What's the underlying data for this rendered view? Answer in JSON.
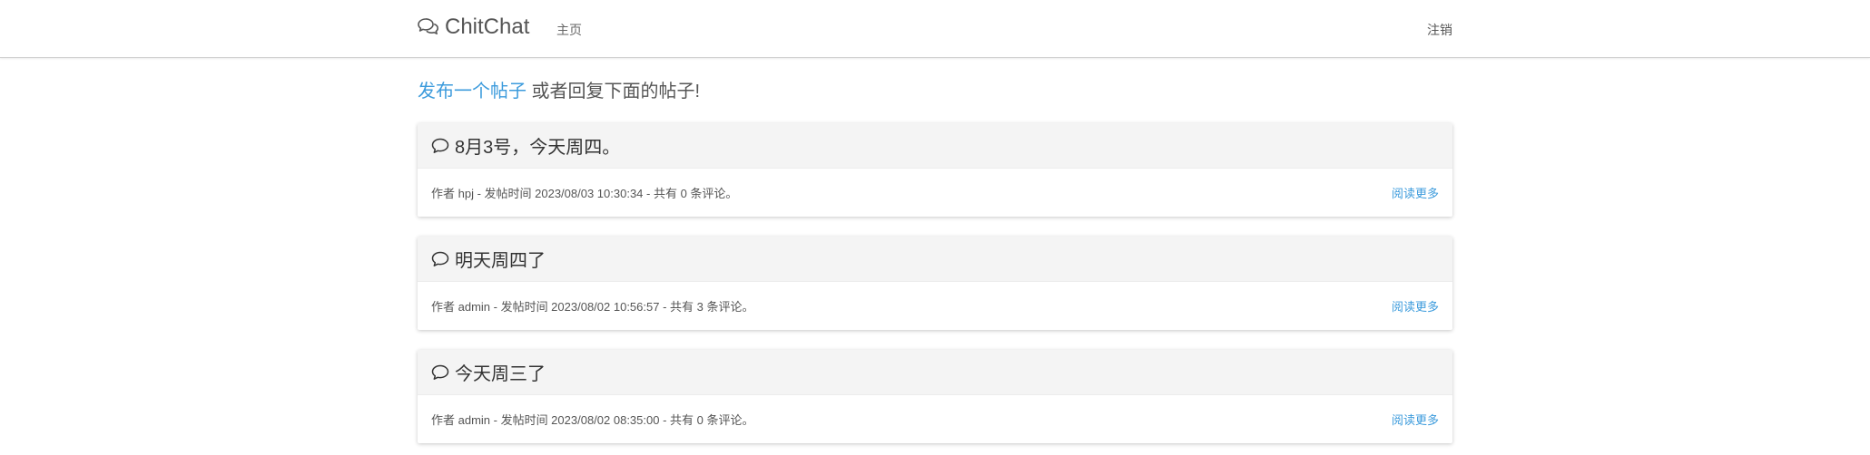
{
  "navbar": {
    "brand": "ChitChat",
    "home_label": "主页",
    "logout_label": "注销"
  },
  "intro": {
    "link_text": "发布一个帖子",
    "rest_text": " 或者回复下面的帖子!"
  },
  "posts": [
    {
      "title": "8月3号，今天周四。",
      "meta": "作者 hpj - 发帖时间 2023/08/03 10:30:34 - 共有 0 条评论。",
      "read_more": "阅读更多"
    },
    {
      "title": "明天周四了",
      "meta": "作者 admin - 发帖时间 2023/08/02 10:56:57 - 共有 3 条评论。",
      "read_more": "阅读更多"
    },
    {
      "title": "今天周三了",
      "meta": "作者 admin - 发帖时间 2023/08/02 08:35:00 - 共有 0 条评论。",
      "read_more": "阅读更多"
    }
  ],
  "colors": {
    "link": "#3c9bdc",
    "card_header": "#f4f4f4"
  },
  "icons": {
    "brand": "comments-icon",
    "post": "comment-icon"
  }
}
